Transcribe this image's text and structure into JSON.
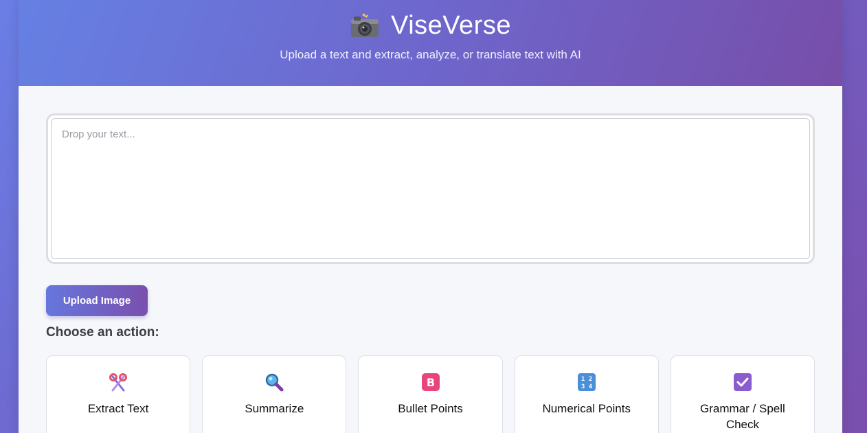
{
  "header": {
    "title": "ViseVerse",
    "subtitle": "Upload a text and extract, analyze, or translate text with AI",
    "icon": "camera-icon"
  },
  "input": {
    "placeholder": "Drop your text...",
    "value": ""
  },
  "upload_button": "Upload Image",
  "actions_label": "Choose an action:",
  "actions": [
    {
      "label": "Extract Text",
      "icon": "scissors-icon"
    },
    {
      "label": "Summarize",
      "icon": "magnifier-icon"
    },
    {
      "label": "Bullet Points",
      "icon": "bold-b-icon"
    },
    {
      "label": "Numerical Points",
      "icon": "numbers-icon"
    },
    {
      "label": "Grammar / Spell Check",
      "icon": "checkbox-icon"
    }
  ],
  "colors": {
    "header_start": "#6680e3",
    "header_end": "#774ea9",
    "panel": "#f6f7fb"
  }
}
